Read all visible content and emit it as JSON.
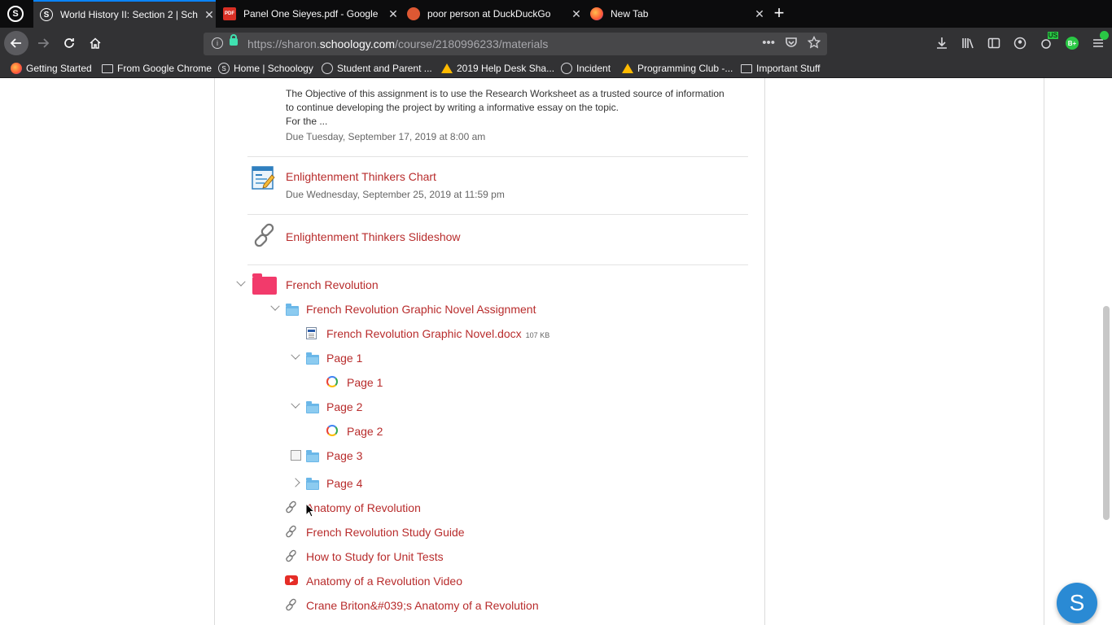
{
  "browser": {
    "tabs": [
      {
        "title": "World History II: Section 2 | Sch",
        "favicon": "schoology-icon",
        "active": true
      },
      {
        "title": "Panel One Sieyes.pdf - Google",
        "favicon": "pdf-icon",
        "favicon_text": "PDF"
      },
      {
        "title": "poor person at DuckDuckGo",
        "favicon": "duckduckgo-icon"
      },
      {
        "title": "New Tab",
        "favicon": "firefox-icon"
      }
    ],
    "url_prefix": "https://sharon.",
    "url_domain": "schoology.com",
    "url_suffix": "/course/2180996233/materials",
    "ext_badge_us": "US",
    "ext_badge_b": "B+",
    "bookmarks": [
      {
        "label": "Getting Started",
        "icon": "firefox-icon"
      },
      {
        "label": "From Google Chrome",
        "icon": "folder-icon"
      },
      {
        "label": "Home | Schoology",
        "icon": "schoology-icon"
      },
      {
        "label": "Student and Parent ...",
        "icon": "globe-icon"
      },
      {
        "label": "2019 Help Desk Sha...",
        "icon": "google-drive-icon"
      },
      {
        "label": "Incident",
        "icon": "globe-icon"
      },
      {
        "label": "Programming Club -...",
        "icon": "google-drive-icon"
      },
      {
        "label": "Important Stuff",
        "icon": "folder-icon"
      }
    ]
  },
  "materials": {
    "assignment_desc_line1": "The Objective of this assignment is to use the Research Worksheet as a trusted source of information",
    "assignment_desc_line2": "to continue developing the project by writing a informative essay on the topic.",
    "assignment_desc_line3": "For the ...",
    "assignment_due": "Due Tuesday, September 17, 2019 at 8:00 am",
    "chart_title": "Enlightenment Thinkers Chart",
    "chart_due": "Due Wednesday, September 25, 2019 at 11:59 pm",
    "slideshow_title": "Enlightenment Thinkers Slideshow",
    "folder_french_revolution": "French Revolution",
    "folder_graphic_novel": "French Revolution Graphic Novel Assignment",
    "file_graphic_novel": "French Revolution Graphic Novel.docx",
    "file_graphic_novel_size": "107 KB",
    "folder_page1": "Page 1",
    "doc_page1": "Page 1",
    "folder_page2": "Page 2",
    "doc_page2": "Page 2",
    "folder_page3": "Page 3",
    "folder_page4": "Page 4",
    "link_anatomy": "Anatomy of Revolution",
    "link_study_guide": "French Revolution Study Guide",
    "link_unit_tests": "How to Study for Unit Tests",
    "video_anatomy": "Anatomy of a Revolution Video",
    "link_crane": "Crane Briton&#039;s Anatomy of a Revolution"
  },
  "help_button": "S"
}
